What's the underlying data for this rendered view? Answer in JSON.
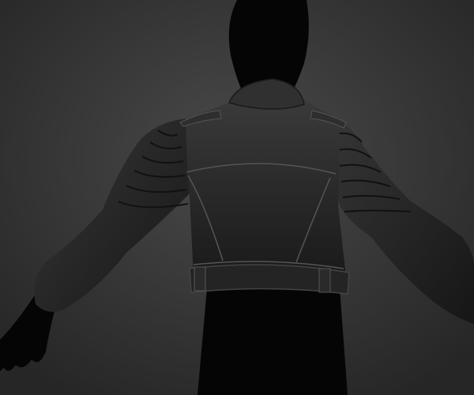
{
  "colors": {
    "background_center": "#4a4a4a",
    "background_edge": "#262626",
    "silhouette": "#050505",
    "jacket_light": "#3a3a3a",
    "jacket_dark": "#161616",
    "seam": "#555555"
  }
}
